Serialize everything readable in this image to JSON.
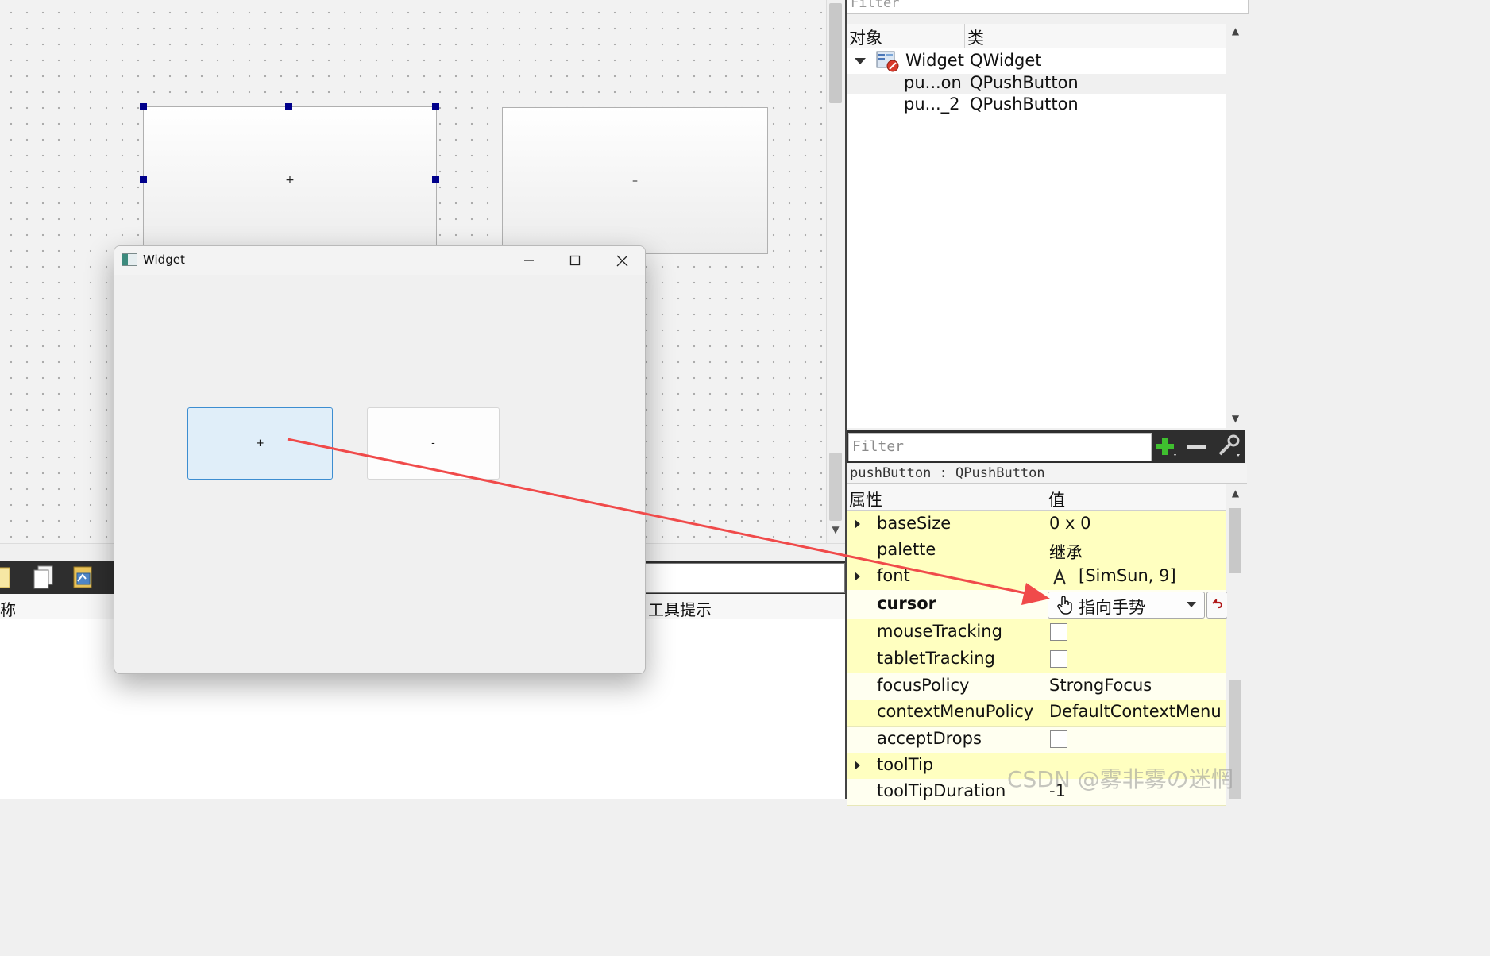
{
  "designer": {
    "button_plus_label": "+",
    "button_minus_label": "–"
  },
  "bottom_panel": {
    "header_name": "称",
    "header_tooltip": "工具提示"
  },
  "widget_window": {
    "title": "Widget",
    "button_plus_label": "+",
    "button_minus_label": "-"
  },
  "object_inspector": {
    "filter_placeholder": "Filter",
    "col_object": "对象",
    "col_class": "类",
    "items": [
      {
        "name": "Widget",
        "class": "QWidget"
      },
      {
        "name": "pu...on",
        "class": "QPushButton"
      },
      {
        "name": "pu..._2",
        "class": "QPushButton"
      }
    ]
  },
  "property_editor": {
    "filter_placeholder": "Filter",
    "class_line": "pushButton : QPushButton",
    "col_property": "属性",
    "col_value": "值",
    "rows": [
      {
        "name": "baseSize",
        "value": "0 x 0"
      },
      {
        "name": "palette",
        "value": "继承"
      },
      {
        "name": "font",
        "value": "[SimSun, 9]"
      },
      {
        "name": "cursor",
        "value": "指向手势"
      },
      {
        "name": "mouseTracking",
        "value": ""
      },
      {
        "name": "tabletTracking",
        "value": ""
      },
      {
        "name": "focusPolicy",
        "value": "StrongFocus"
      },
      {
        "name": "contextMenuPolicy",
        "value": "DefaultContextMenu"
      },
      {
        "name": "acceptDrops",
        "value": ""
      },
      {
        "name": "toolTip",
        "value": ""
      },
      {
        "name": "toolTipDuration",
        "value": "-1"
      }
    ]
  },
  "watermark": "CSDN @雾非雾の迷惘",
  "colors": {
    "arrow": "#f04a4a",
    "selection_handle": "#00008b",
    "property_row": "#ffffc0"
  }
}
